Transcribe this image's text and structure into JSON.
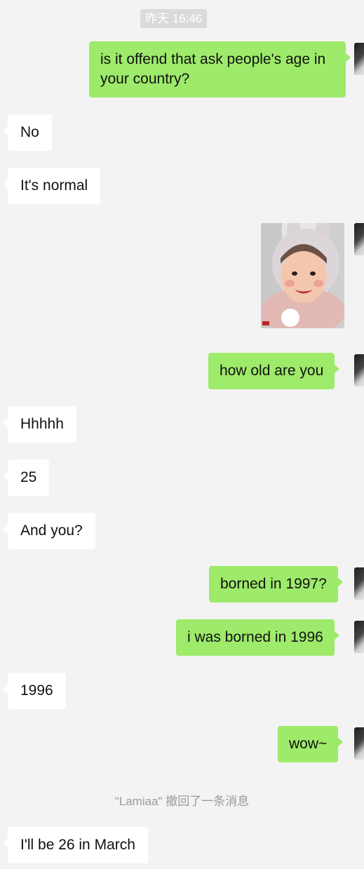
{
  "chat": {
    "timestamp": "昨天 16:46",
    "messages": [
      {
        "side": "out",
        "text": "is it offend that ask people's age in your country?"
      },
      {
        "side": "in",
        "text": "No"
      },
      {
        "side": "in",
        "text": "It's normal"
      },
      {
        "side": "out",
        "type": "image",
        "image_icon": "hooded-child-sticker"
      },
      {
        "side": "out",
        "text": "how old are you"
      },
      {
        "side": "in",
        "text": "Hhhhh"
      },
      {
        "side": "in",
        "text": "25"
      },
      {
        "side": "in",
        "text": "And you?"
      },
      {
        "side": "out",
        "text": "borned in 1997?"
      },
      {
        "side": "out",
        "text": "i was borned in 1996"
      },
      {
        "side": "in",
        "text": "1996"
      },
      {
        "side": "out",
        "text": "wow~"
      },
      {
        "side": "in",
        "text": "I'll be 26 in March"
      }
    ],
    "recall_notice": "\"Lamiaa\" 撤回了一条消息"
  },
  "colors": {
    "background": "#f3f3f3",
    "outgoing_bubble": "#9eea6a",
    "incoming_bubble": "#ffffff",
    "system_text": "#9a9a9a"
  }
}
